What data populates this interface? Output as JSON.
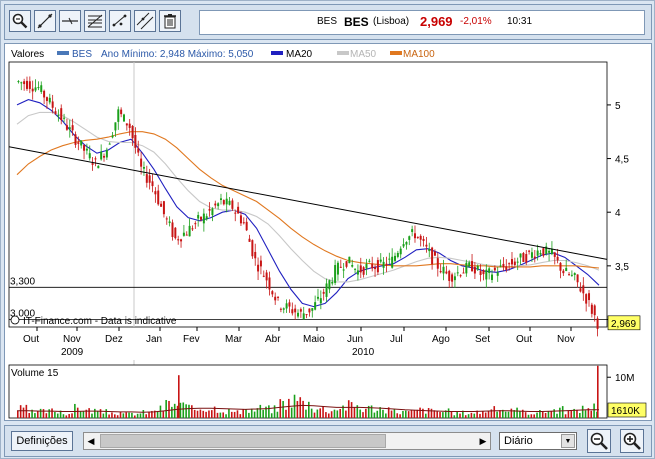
{
  "toolbar": {
    "tools": [
      "zoom-icon",
      "line-draw-icon",
      "horizontal-line-icon",
      "fibonacci-icon",
      "trend-channel-icon",
      "parallel-lines-icon",
      "trash-icon"
    ]
  },
  "quote": {
    "ticker_small": "BES",
    "ticker": "BES",
    "exchange": "(Lisboa)",
    "price": "2,969",
    "change": "-2,01%",
    "time": "10:31"
  },
  "legend": {
    "label": "Valores",
    "series_name": "BES",
    "range_text": "Ano Mínimo: 2,948 Máximo: 5,050",
    "ma20": "MA20",
    "ma50": "MA50",
    "ma100": "MA100"
  },
  "colors": {
    "up": "#1aa01a",
    "down": "#c81414",
    "ma20": "#2020c0",
    "ma50": "#c8c8c8",
    "ma100": "#e07820",
    "price_badge_bg": "#ffff66",
    "trend": "#000000",
    "volume_ma": "#7a1010"
  },
  "credit": "IT-Finance.com - Data is indicative",
  "price_axis": {
    "ticks": [
      "5",
      "4,5",
      "4",
      "3,5",
      "3"
    ],
    "left_levels": [
      "3,300",
      "3,000"
    ],
    "current_badge": "2,969"
  },
  "x_axis": {
    "months": [
      "Out",
      "Nov",
      "Dez",
      "Jan",
      "Fev",
      "Mar",
      "Abr",
      "Maio",
      "Jun",
      "Jul",
      "Ago",
      "Set",
      "Out",
      "Nov"
    ],
    "years": [
      "2009",
      "2010"
    ]
  },
  "volume": {
    "label": "Volume 15",
    "tick": "10M",
    "current_badge": "1610K"
  },
  "bottom": {
    "definitions": "Definições",
    "period": "Diário"
  },
  "chart_data": [
    {
      "type": "candlestick",
      "title": "BES (Lisboa)",
      "ylabel": "",
      "ylim": [
        2.93,
        5.4
      ],
      "y_min_year": 2.948,
      "y_max_year": 5.05,
      "horizontal_levels": [
        3.3,
        3.0
      ],
      "trendline": {
        "start": [
          "Set 2009",
          4.61
        ],
        "end": [
          "Nov 2010",
          3.56
        ]
      },
      "series": [
        {
          "name": "BES",
          "values": [
            5.22,
            5.2,
            5.16,
            5.02,
            4.88,
            4.72,
            4.58,
            4.45,
            4.6,
            4.93,
            4.8,
            4.4,
            4.25,
            3.98,
            3.75,
            3.82,
            3.92,
            4.0,
            4.1,
            4.05,
            3.9,
            3.55,
            3.38,
            3.15,
            3.1,
            3.05,
            3.1,
            3.25,
            3.45,
            3.55,
            3.45,
            3.5,
            3.5,
            3.55,
            3.75,
            3.8,
            3.65,
            3.5,
            3.4,
            3.45,
            3.5,
            3.4,
            3.45,
            3.5,
            3.55,
            3.6,
            3.65,
            3.6,
            3.45,
            3.38,
            3.2,
            2.97
          ]
        },
        {
          "name": "MA20",
          "values": [
            5.0,
            5.05,
            5.02,
            4.95,
            4.85,
            4.72,
            4.62,
            4.55,
            4.58,
            4.65,
            4.68,
            4.55,
            4.4,
            4.22,
            4.05,
            3.95,
            3.92,
            3.95,
            4.0,
            4.02,
            3.98,
            3.85,
            3.65,
            3.45,
            3.28,
            3.15,
            3.12,
            3.15,
            3.25,
            3.38,
            3.45,
            3.48,
            3.5,
            3.52,
            3.58,
            3.65,
            3.66,
            3.62,
            3.55,
            3.5,
            3.48,
            3.45,
            3.44,
            3.46,
            3.5,
            3.55,
            3.6,
            3.62,
            3.58,
            3.5,
            3.42,
            3.32
          ]
        },
        {
          "name": "MA50",
          "values": [
            4.82,
            4.9,
            4.93,
            4.93,
            4.9,
            4.84,
            4.77,
            4.7,
            4.66,
            4.65,
            4.65,
            4.62,
            4.56,
            4.45,
            4.32,
            4.2,
            4.1,
            4.04,
            4.02,
            4.02,
            4.0,
            3.96,
            3.89,
            3.78,
            3.66,
            3.55,
            3.45,
            3.38,
            3.35,
            3.35,
            3.37,
            3.4,
            3.43,
            3.46,
            3.5,
            3.54,
            3.57,
            3.58,
            3.57,
            3.55,
            3.53,
            3.51,
            3.5,
            3.49,
            3.5,
            3.51,
            3.53,
            3.55,
            3.55,
            3.53,
            3.5,
            3.46
          ]
        },
        {
          "name": "MA100",
          "values": [
            4.35,
            4.45,
            4.52,
            4.58,
            4.62,
            4.65,
            4.67,
            4.68,
            4.7,
            4.73,
            4.75,
            4.75,
            4.73,
            4.68,
            4.6,
            4.5,
            4.4,
            4.32,
            4.25,
            4.2,
            4.15,
            4.1,
            4.02,
            3.94,
            3.85,
            3.77,
            3.7,
            3.64,
            3.59,
            3.55,
            3.53,
            3.52,
            3.51,
            3.5,
            3.5,
            3.5,
            3.51,
            3.52,
            3.52,
            3.51,
            3.5,
            3.5,
            3.49,
            3.49,
            3.49,
            3.49,
            3.5,
            3.5,
            3.5,
            3.5,
            3.49,
            3.48
          ]
        }
      ]
    },
    {
      "type": "bar",
      "title": "Volume 15",
      "ylabel": "",
      "ylim": [
        0,
        13
      ],
      "unit": "M",
      "series": [
        {
          "name": "Volume",
          "values": [
            2.2,
            1.4,
            1.6,
            1.8,
            1.2,
            2.4,
            1.9,
            1.5,
            1.3,
            1.0,
            1.1,
            1.4,
            2.2,
            3.5,
            3.0,
            2.2,
            2.6,
            2.5,
            1.8,
            1.4,
            2.0,
            2.4,
            2.2,
            3.8,
            4.6,
            3.6,
            2.4,
            2.0,
            2.8,
            3.1,
            2.4,
            2.5,
            1.8,
            1.6,
            1.5,
            2.0,
            1.8,
            1.6,
            1.2,
            1.3,
            1.5,
            2.0,
            2.2,
            1.7,
            1.5,
            1.4,
            1.8,
            2.0,
            1.6,
            2.3,
            2.7,
            1.61
          ]
        },
        {
          "name": "Volume 15",
          "values": [
            1.8,
            1.8,
            1.7,
            1.7,
            1.6,
            1.6,
            1.7,
            1.7,
            1.6,
            1.5,
            1.5,
            1.4,
            1.5,
            1.8,
            2.1,
            2.3,
            2.4,
            2.4,
            2.3,
            2.2,
            2.1,
            2.2,
            2.3,
            2.6,
            2.9,
            3.1,
            3.0,
            2.8,
            2.6,
            2.6,
            2.6,
            2.5,
            2.4,
            2.2,
            2.0,
            1.9,
            1.8,
            1.7,
            1.6,
            1.6,
            1.6,
            1.7,
            1.8,
            1.8,
            1.7,
            1.6,
            1.6,
            1.7,
            1.8,
            1.9,
            2.0,
            2.0
          ]
        }
      ]
    }
  ]
}
